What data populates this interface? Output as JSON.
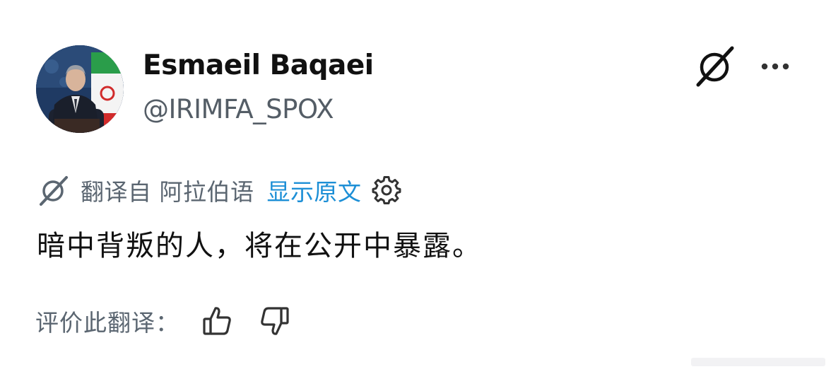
{
  "author": {
    "display_name": "Esmaeil Baqaei",
    "handle": "@IRIMFA_SPOX",
    "avatar_icon": "profile-photo"
  },
  "header_actions": {
    "grok_icon": "grok-icon",
    "more_icon": "more-dots-icon"
  },
  "translation": {
    "icon": "grok-translate-icon",
    "translated_from": "翻译自 阿拉伯语",
    "show_original": "显示原文",
    "settings_icon": "gear-icon"
  },
  "tweet": {
    "text": "暗中背叛的人，将在公开中暴露。"
  },
  "rating": {
    "label": "评价此翻译：",
    "thumbs_up_icon": "thumbs-up-icon",
    "thumbs_down_icon": "thumbs-down-icon"
  },
  "colors": {
    "text": "#111111",
    "secondary": "#5b6671",
    "link": "#1d8fd6"
  }
}
